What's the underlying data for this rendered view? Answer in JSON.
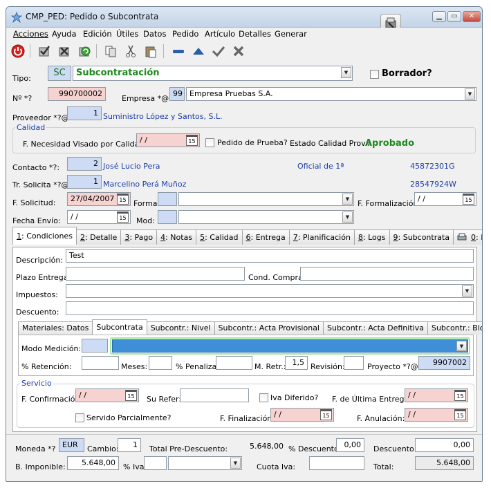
{
  "window": {
    "title": "CMP_PED: Pedido o Subcontrata",
    "minimize": "▁",
    "restore": "▭",
    "close": "✕"
  },
  "menu": [
    "Acciones",
    "Ayuda",
    "Edición",
    "Útiles",
    "Datos",
    "Pedido",
    "Artículo",
    "Detalles",
    "Generar"
  ],
  "toolbar_icons": [
    "exit-icon",
    "check-list-icon",
    "delete-list-icon",
    "refresh-icon",
    "copy-icon",
    "cut-icon",
    "paste-icon",
    "minus-icon",
    "triangle-up-icon",
    "checkmark-icon",
    "cross-icon"
  ],
  "header": {
    "tipo_label": "Tipo:",
    "tipo_code": "SC",
    "tipo_value": "Subcontratación",
    "borrador_label": "Borrador?",
    "numero_label": "Nº *?",
    "numero_value": "990700002",
    "empresa_label": "Empresa *@:",
    "empresa_code": "99",
    "empresa_value": "Empresa Pruebas S.A.",
    "proveedor_label": "Proveedor *?@:",
    "proveedor_code": "1",
    "proveedor_value": "Suministro López y Santos, S.L."
  },
  "calidad": {
    "title": "Calidad",
    "fnec_label": "F. Necesidad Visado por Calidad:",
    "fnec_value": " / /",
    "prueba_label": "Pedido de Prueba?",
    "estado_label": "Estado Calidad Prov.:",
    "estado_value": "Aprobado"
  },
  "contacto": {
    "label": "Contacto *?:",
    "code": "2",
    "name": "José Lucio Pera",
    "role": "Oficial de 1ª",
    "id": "45872301G"
  },
  "solicita": {
    "label": "Tr. Solicita *?@:",
    "code": "1",
    "name": "Marcelino Perá Muñoz",
    "id": "28547924W"
  },
  "fechas": {
    "fsol_label": "F. Solicitud:",
    "fsol_value": "27/04/2007",
    "forma_label": "Forma:",
    "fform_label": "F. Formalización:",
    "fform_value": " / /",
    "fenvio_label": "Fecha Envío:",
    "fenvio_value": " / /",
    "mod_label": "Mod:",
    "cal_icon": "15"
  },
  "tabs": [
    {
      "key": "1",
      "label": ": Condiciones"
    },
    {
      "key": "2",
      "label": ": Detalle"
    },
    {
      "key": "3",
      "label": ": Pago"
    },
    {
      "key": "4",
      "label": ": Notas"
    },
    {
      "key": "5",
      "label": ": Calidad"
    },
    {
      "key": "6",
      "label": ": Entrega"
    },
    {
      "key": "7",
      "label": ": Planificación"
    },
    {
      "key": "8",
      "label": ": Logs"
    },
    {
      "key": "9",
      "label": ": Subcontrata"
    },
    {
      "key": "0",
      "label": ": Imprimir"
    }
  ],
  "condiciones": {
    "desc_label": "Descripción:",
    "desc_value": "Test",
    "plazo_label": "Plazo Entrega:",
    "cond_label": "Cond. Compra:",
    "impuestos_label": "Impuestos:",
    "descuento_label": "Descuento:"
  },
  "subtabs": [
    "Materiales: Datos",
    "Subcontrata",
    "Subcontr.: Nivel",
    "Subcontr.: Acta Provisional",
    "Subcontr.: Acta Definitiva",
    "Subcontr.: Bloqueo Ret."
  ],
  "subcontrata": {
    "modo_label": "Modo Medición:",
    "retencion_label": "% Retención:",
    "meses_label": "Meses:",
    "penaliza_label": "% Penaliza:",
    "mretr_label": "M. Retr.:",
    "mretr_value": "1,5",
    "revision_label": "Revisión:",
    "proyecto_label": "Proyecto *?@",
    "proyecto_value": "9907002"
  },
  "servicio": {
    "title": "Servicio",
    "fconf_label": "F. Confirmación:",
    "fconf_value": " / /",
    "surefer_label": "Su Refer:",
    "ivadif_label": "Iva Diferido?",
    "fultima_label": "F. de Última Entrega:",
    "fultima_value": " / /",
    "servido_label": "Servido Parcialmente?",
    "ffin_label": "F. Finalización:",
    "ffin_value": " / /",
    "fanul_label": "F. Anulación:",
    "fanul_value": " / /"
  },
  "totales": {
    "moneda_label": "Moneda *?",
    "moneda_value": "EUR",
    "cambio_label": "Cambio:",
    "cambio_value": "1",
    "totalpre_label": "Total Pre-Descuento:",
    "totalpre_value": "5.648,00",
    "pdesc_label": "% Descuento.:",
    "pdesc_value": "0,00",
    "desc_label": "Descuento:",
    "desc_value": "0,00",
    "bimp_label": "B. Imponible:",
    "bimp_value": "5.648,00",
    "piva_label": "% Iva:",
    "cuota_label": "Cuota Iva:",
    "total_label": "Total:",
    "total_value": "5.648,00"
  }
}
